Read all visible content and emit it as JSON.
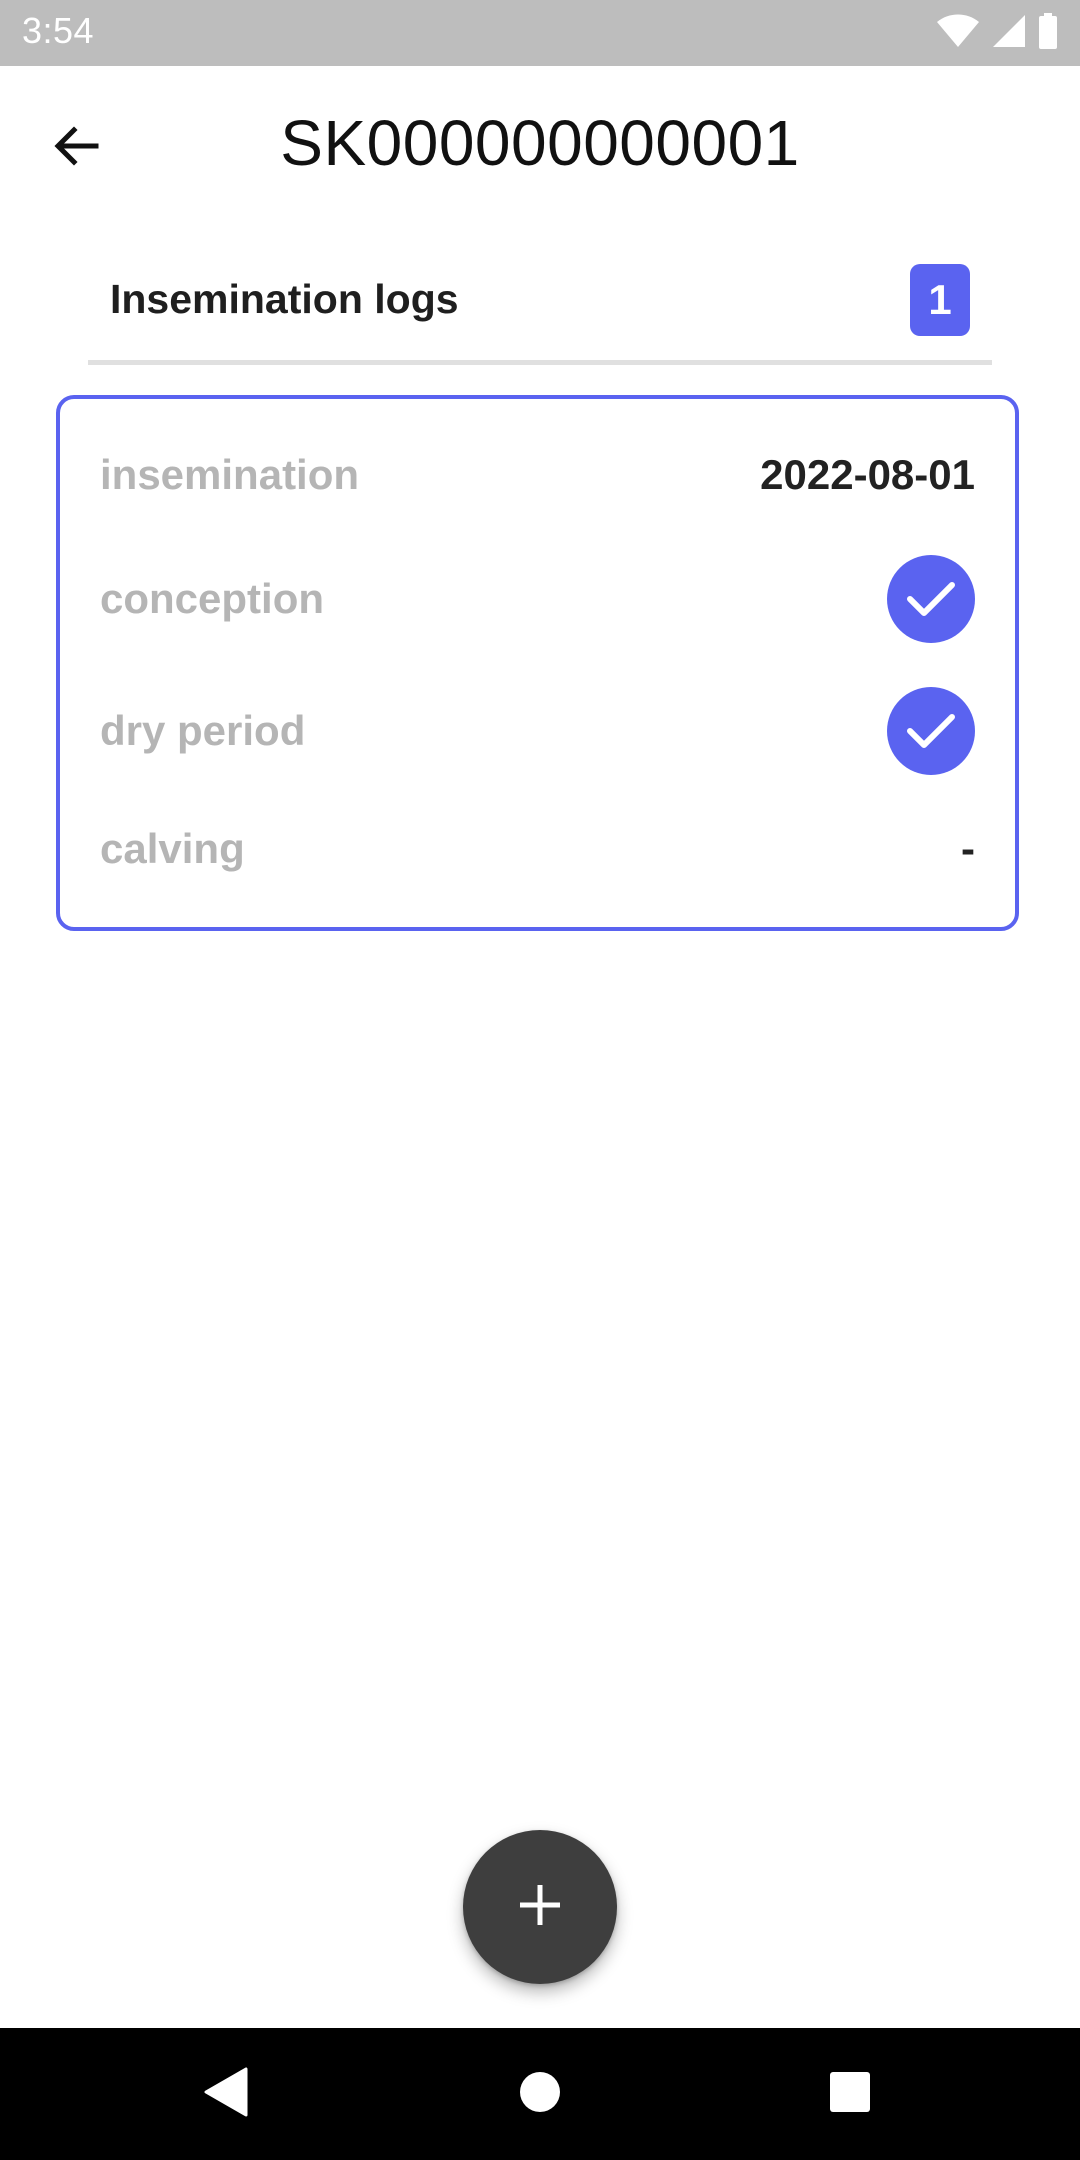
{
  "status_bar": {
    "time": "3:54",
    "icons": [
      "wifi-icon",
      "signal-icon",
      "battery-icon"
    ]
  },
  "app_bar": {
    "title": "SK000000000001",
    "back_icon": "arrow-back-icon"
  },
  "section": {
    "title": "Insemination logs",
    "count": "1"
  },
  "log_card": {
    "rows": [
      {
        "label": "insemination",
        "value": "2022-08-01"
      },
      {
        "label": "conception",
        "value": "check",
        "icon": "check-circle-icon"
      },
      {
        "label": "dry period",
        "value": "check",
        "icon": "check-circle-icon"
      },
      {
        "label": "calving",
        "value": "-"
      }
    ]
  },
  "fab": {
    "icon": "plus-icon"
  },
  "nav_bar": {
    "icons": [
      "back-triangle-icon",
      "home-circle-icon",
      "recents-square-icon"
    ]
  },
  "colors": {
    "accent": "#5a63f0",
    "status_bar": "#bdbdbd",
    "fab": "#3e3e3e",
    "label_gray": "#b5b5b5"
  }
}
